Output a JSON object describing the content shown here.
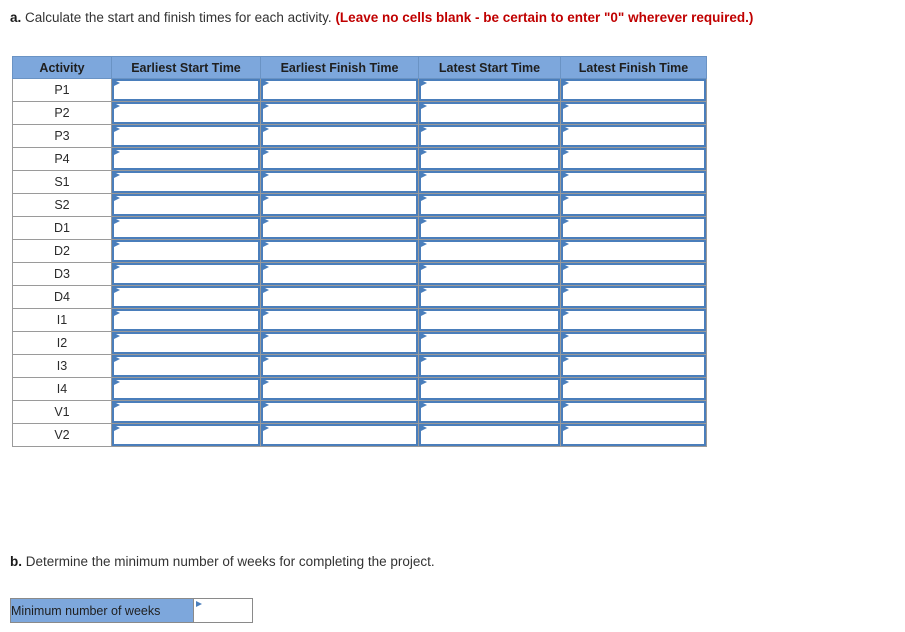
{
  "question_a": {
    "label": "a.",
    "text": "Calculate the start and finish times for each activity.",
    "note": "(Leave no cells blank - be certain to enter \"0\" wherever required.)"
  },
  "table": {
    "columns": [
      "Activity",
      "Earliest Start Time",
      "Earliest Finish Time",
      "Latest Start Time",
      "Latest Finish Time"
    ],
    "rows": [
      {
        "activity": "P1",
        "earliest_start": "",
        "earliest_finish": "",
        "latest_start": "",
        "latest_finish": ""
      },
      {
        "activity": "P2",
        "earliest_start": "",
        "earliest_finish": "",
        "latest_start": "",
        "latest_finish": ""
      },
      {
        "activity": "P3",
        "earliest_start": "",
        "earliest_finish": "",
        "latest_start": "",
        "latest_finish": ""
      },
      {
        "activity": "P4",
        "earliest_start": "",
        "earliest_finish": "",
        "latest_start": "",
        "latest_finish": ""
      },
      {
        "activity": "S1",
        "earliest_start": "",
        "earliest_finish": "",
        "latest_start": "",
        "latest_finish": ""
      },
      {
        "activity": "S2",
        "earliest_start": "",
        "earliest_finish": "",
        "latest_start": "",
        "latest_finish": ""
      },
      {
        "activity": "D1",
        "earliest_start": "",
        "earliest_finish": "",
        "latest_start": "",
        "latest_finish": ""
      },
      {
        "activity": "D2",
        "earliest_start": "",
        "earliest_finish": "",
        "latest_start": "",
        "latest_finish": ""
      },
      {
        "activity": "D3",
        "earliest_start": "",
        "earliest_finish": "",
        "latest_start": "",
        "latest_finish": ""
      },
      {
        "activity": "D4",
        "earliest_start": "",
        "earliest_finish": "",
        "latest_start": "",
        "latest_finish": ""
      },
      {
        "activity": "I1",
        "earliest_start": "",
        "earliest_finish": "",
        "latest_start": "",
        "latest_finish": ""
      },
      {
        "activity": "I2",
        "earliest_start": "",
        "earliest_finish": "",
        "latest_start": "",
        "latest_finish": ""
      },
      {
        "activity": "I3",
        "earliest_start": "",
        "earliest_finish": "",
        "latest_start": "",
        "latest_finish": ""
      },
      {
        "activity": "I4",
        "earliest_start": "",
        "earliest_finish": "",
        "latest_start": "",
        "latest_finish": ""
      },
      {
        "activity": "V1",
        "earliest_start": "",
        "earliest_finish": "",
        "latest_start": "",
        "latest_finish": ""
      },
      {
        "activity": "V2",
        "earliest_start": "",
        "earliest_finish": "",
        "latest_start": "",
        "latest_finish": ""
      }
    ]
  },
  "question_b": {
    "label": "b.",
    "text": "Determine the minimum number of weeks for completing the project."
  },
  "minimum_weeks": {
    "label": "Minimum number of weeks",
    "value": ""
  },
  "colors": {
    "header_blue": "#7da7dc",
    "input_border_blue": "#4a7ebb",
    "note_red": "#c00000",
    "cell_border_gray": "#9a9a9a"
  }
}
